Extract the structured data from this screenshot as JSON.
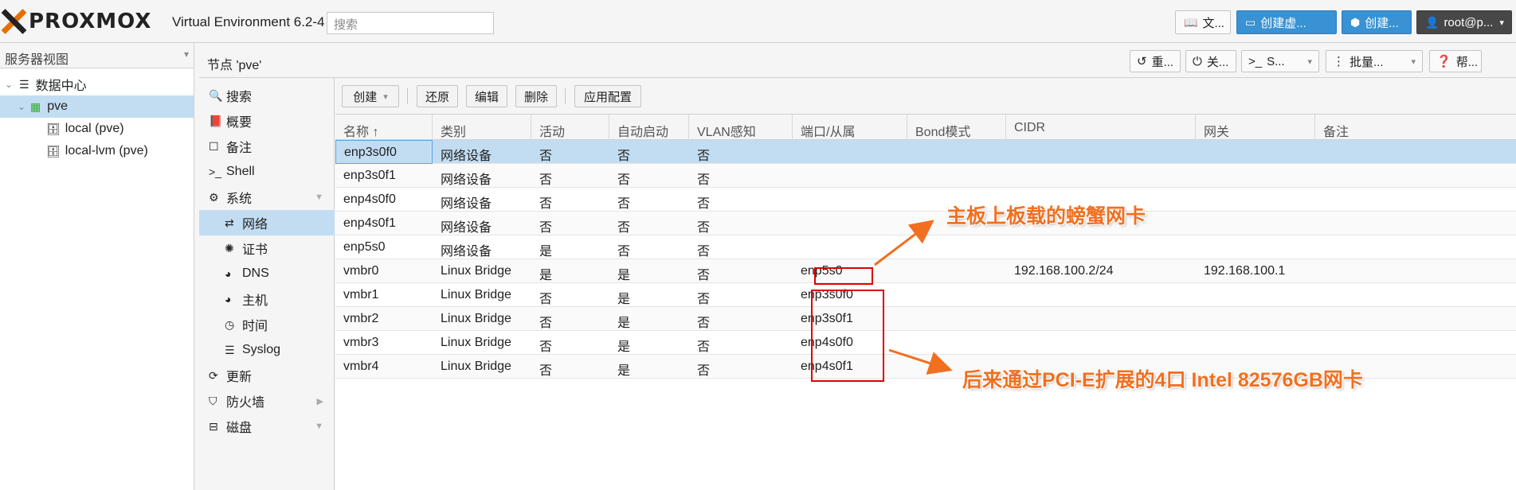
{
  "header": {
    "logo": "PROXMOX",
    "version": "Virtual Environment 6.2-4",
    "search_placeholder": "搜索",
    "btn_docs": "文...",
    "btn_create_vm": "创建虚...",
    "btn_create_ct": "创建...",
    "btn_user": "root@p..."
  },
  "tree": {
    "view_label": "服务器视图",
    "items": [
      {
        "label": "数据中心"
      },
      {
        "label": "pve"
      },
      {
        "label": "local (pve)"
      },
      {
        "label": "local-lvm (pve)"
      }
    ]
  },
  "nodebar": {
    "title": "节点 'pve'",
    "btn_restart": "重...",
    "btn_shutdown": "关...",
    "btn_shell": "S...",
    "btn_bulk": "批量...",
    "btn_help": "帮..."
  },
  "nav": {
    "items": [
      {
        "label": "搜索"
      },
      {
        "label": "概要"
      },
      {
        "label": "备注"
      },
      {
        "label": "Shell"
      },
      {
        "label": "系统"
      },
      {
        "label": "网络"
      },
      {
        "label": "证书"
      },
      {
        "label": "DNS"
      },
      {
        "label": "主机"
      },
      {
        "label": "时间"
      },
      {
        "label": "Syslog"
      },
      {
        "label": "更新"
      },
      {
        "label": "防火墙"
      },
      {
        "label": "磁盘"
      }
    ]
  },
  "toolbar": {
    "create": "创建",
    "revert": "还原",
    "edit": "编辑",
    "delete": "删除",
    "apply": "应用配置"
  },
  "table": {
    "columns": [
      "名称 ↑",
      "类别",
      "活动",
      "自动启动",
      "VLAN感知",
      "端口/从属",
      "Bond模式",
      "CIDR",
      "网关",
      "备注"
    ],
    "rows": [
      [
        "enp3s0f0",
        "网络设备",
        "否",
        "否",
        "否",
        "",
        "",
        "",
        "",
        ""
      ],
      [
        "enp3s0f1",
        "网络设备",
        "否",
        "否",
        "否",
        "",
        "",
        "",
        "",
        ""
      ],
      [
        "enp4s0f0",
        "网络设备",
        "否",
        "否",
        "否",
        "",
        "",
        "",
        "",
        ""
      ],
      [
        "enp4s0f1",
        "网络设备",
        "否",
        "否",
        "否",
        "",
        "",
        "",
        "",
        ""
      ],
      [
        "enp5s0",
        "网络设备",
        "是",
        "否",
        "否",
        "",
        "",
        "",
        "",
        ""
      ],
      [
        "vmbr0",
        "Linux Bridge",
        "是",
        "是",
        "否",
        "enp5s0",
        "",
        "192.168.100.2/24",
        "192.168.100.1",
        ""
      ],
      [
        "vmbr1",
        "Linux Bridge",
        "否",
        "是",
        "否",
        "enp3s0f0",
        "",
        "",
        "",
        ""
      ],
      [
        "vmbr2",
        "Linux Bridge",
        "否",
        "是",
        "否",
        "enp3s0f1",
        "",
        "",
        "",
        ""
      ],
      [
        "vmbr3",
        "Linux Bridge",
        "否",
        "是",
        "否",
        "enp4s0f0",
        "",
        "",
        "",
        ""
      ],
      [
        "vmbr4",
        "Linux Bridge",
        "否",
        "是",
        "否",
        "enp4s0f1",
        "",
        "",
        "",
        ""
      ]
    ]
  },
  "annotations": {
    "onboard": "主板上板载的螃蟹网卡",
    "pcie": "后来通过PCI-E扩展的4口 Intel 82576GB网卡",
    "accent_color": "#f07020",
    "box_color": "#e00000"
  }
}
